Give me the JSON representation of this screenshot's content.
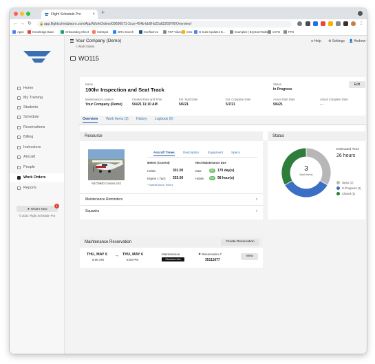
{
  "browser": {
    "tab_title": "Flight Schedule Pro",
    "url": "app.flightschedulepro.com/App/WorkOrders/09606071-2cce-454b-bb9f-b22a62269f76/Overview/",
    "bookmarks": [
      "Apps",
      "Knowledge Base",
      "Onboarding Sheet",
      "HubSpot",
      "JIRA Search",
      "Confluence",
      "FSP Video",
      "Intro",
      "G Suite Updates B...",
      "Examples | BryntumTasks",
      "eCFIs",
      "FFD"
    ],
    "colors": {
      "close": "#ff5f57",
      "min": "#febc2e",
      "max": "#28c840"
    }
  },
  "header": {
    "company": "Your Company (Demo)",
    "back_link": "< Work Orders",
    "help": "Help",
    "settings": "Settings",
    "user": "Andrew",
    "page_title": "WO115"
  },
  "sidebar": {
    "items": [
      {
        "label": "Home",
        "icon": "home-icon"
      },
      {
        "label": "My Training",
        "icon": "training-icon"
      },
      {
        "label": "Students",
        "icon": "students-icon"
      },
      {
        "label": "Schedule",
        "icon": "calendar-icon"
      },
      {
        "label": "Reservations",
        "icon": "list-icon"
      },
      {
        "label": "Billing",
        "icon": "billing-icon"
      },
      {
        "label": "Instructors",
        "icon": "instructor-icon"
      },
      {
        "label": "Aircraft",
        "icon": "plane-icon"
      },
      {
        "label": "People",
        "icon": "people-icon"
      },
      {
        "label": "Work Orders",
        "icon": "wrench-icon"
      },
      {
        "label": "Reports",
        "icon": "reports-icon"
      }
    ],
    "active": "Work Orders",
    "whats_new": "★ What's New",
    "whats_new_badge": "1",
    "copyright": "© 2021 Flight Schedule Pro"
  },
  "summary": {
    "name_label": "Name",
    "name": "100hr Inspection and Seat Track",
    "status_label": "Status",
    "status": "In Progress",
    "edit": "Edit",
    "fields": [
      {
        "label": "Maintenance Location",
        "value": "Your Company (Demo)"
      },
      {
        "label": "Created Date and Time",
        "value": "5/4/21 11:10 AM"
      },
      {
        "label": "Est. Start Date",
        "value": "5/6/21"
      },
      {
        "label": "Est. Complete Date",
        "value": "5/7/21"
      },
      {
        "label": "Actual Start Date",
        "value": "5/6/21"
      },
      {
        "label": "Actual Complete Date",
        "value": "- -"
      }
    ],
    "tabs": [
      "Overview",
      "Work Items (3)",
      "History",
      "Logbook (0)"
    ]
  },
  "resource": {
    "title": "Resource",
    "image_caption": "N4729MO Cessna 152",
    "subtabs": [
      "Aircraft Times",
      "Description",
      "Equipment",
      "Specs"
    ],
    "meters_label": "Meters (Current)",
    "meters": [
      {
        "label": "Hobbs",
        "value": "301.00"
      },
      {
        "label": "Engine 1 Tach",
        "value": "333.00"
      }
    ],
    "next_label": "Next Maintenance Due",
    "next": [
      {
        "label": "Date",
        "value": "170 day(s)",
        "pill": "BR"
      },
      {
        "label": "Hobbs",
        "value": "98 hour(s)",
        "pill": "BR"
      }
    ],
    "maintenance_link": "+ Maintenance Timers",
    "rows": [
      "Maintenance Reminders",
      "Squawks"
    ]
  },
  "reservation": {
    "title": "Maintenance Reservation",
    "create_button": "Create Reservation",
    "start_date": "THU, MAY 6",
    "start_time": "8:00 AM",
    "end_date": "THU, MAY 6",
    "end_time": "5:00 PM",
    "type_label": "Maintenance",
    "checked_out": "Checked Out",
    "res_label": "Reservation #",
    "res_number": "35111677",
    "view": "View"
  },
  "status_card": {
    "title": "Status",
    "center_value": "3",
    "center_label": "Work Items",
    "estimated_label": "Estimated Time",
    "estimated_value": "26 hours",
    "chart_data": {
      "type": "pie",
      "values": [
        1,
        1,
        1
      ],
      "labels": [
        "Open (1)",
        "In Progress (1)",
        "Closed (1)"
      ],
      "colors": [
        "#b7b7b7",
        "#3a6fc4",
        "#2e7d3b"
      ]
    }
  }
}
